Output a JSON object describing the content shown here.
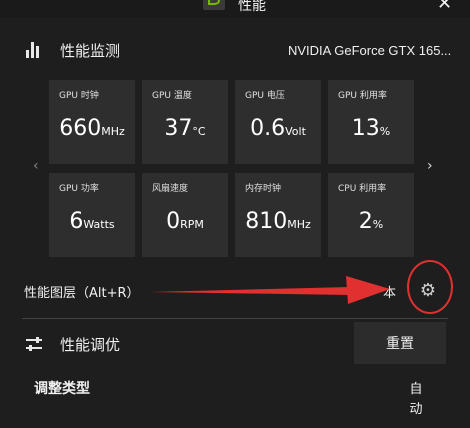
{
  "window": {
    "title": "性能",
    "close_glyph": "✕"
  },
  "monitor": {
    "title": "性能监测",
    "gpu_name": "NVIDIA GeForce GTX 165...",
    "tiles": [
      {
        "label": "GPU 时钟",
        "value": "660",
        "unit": "MHz"
      },
      {
        "label": "GPU 温度",
        "value": "37",
        "unit": "°C"
      },
      {
        "label": "GPU 电压",
        "value": "0.6",
        "unit": "Volt"
      },
      {
        "label": "GPU 利用率",
        "value": "13",
        "unit": "%"
      },
      {
        "label": "GPU 功率",
        "value": "6",
        "unit": "Watts"
      },
      {
        "label": "风扇速度",
        "value": "0",
        "unit": "RPM"
      },
      {
        "label": "内存时钟",
        "value": "810",
        "unit": "MHz"
      },
      {
        "label": "CPU 利用率",
        "value": "2",
        "unit": "%"
      }
    ],
    "prev_glyph": "‹",
    "next_glyph": "›"
  },
  "overlay": {
    "label": "性能图层（Alt+R）",
    "state_text": "本"
  },
  "tuning": {
    "title": "性能调优",
    "reset_label": "重置",
    "adjust_type_label": "调整类型",
    "adjust_type_value": "自动"
  },
  "colors": {
    "background": "#1e1e1e",
    "tile": "#2e2e2e",
    "accent": "#76b900",
    "annotation": "#e03030"
  },
  "icons": [
    "nvidia-logo",
    "close-icon",
    "bar-chart-icon",
    "chevron-left-icon",
    "chevron-right-icon",
    "gear-icon",
    "sliders-icon",
    "red-arrow-annotation",
    "red-circle-annotation"
  ]
}
